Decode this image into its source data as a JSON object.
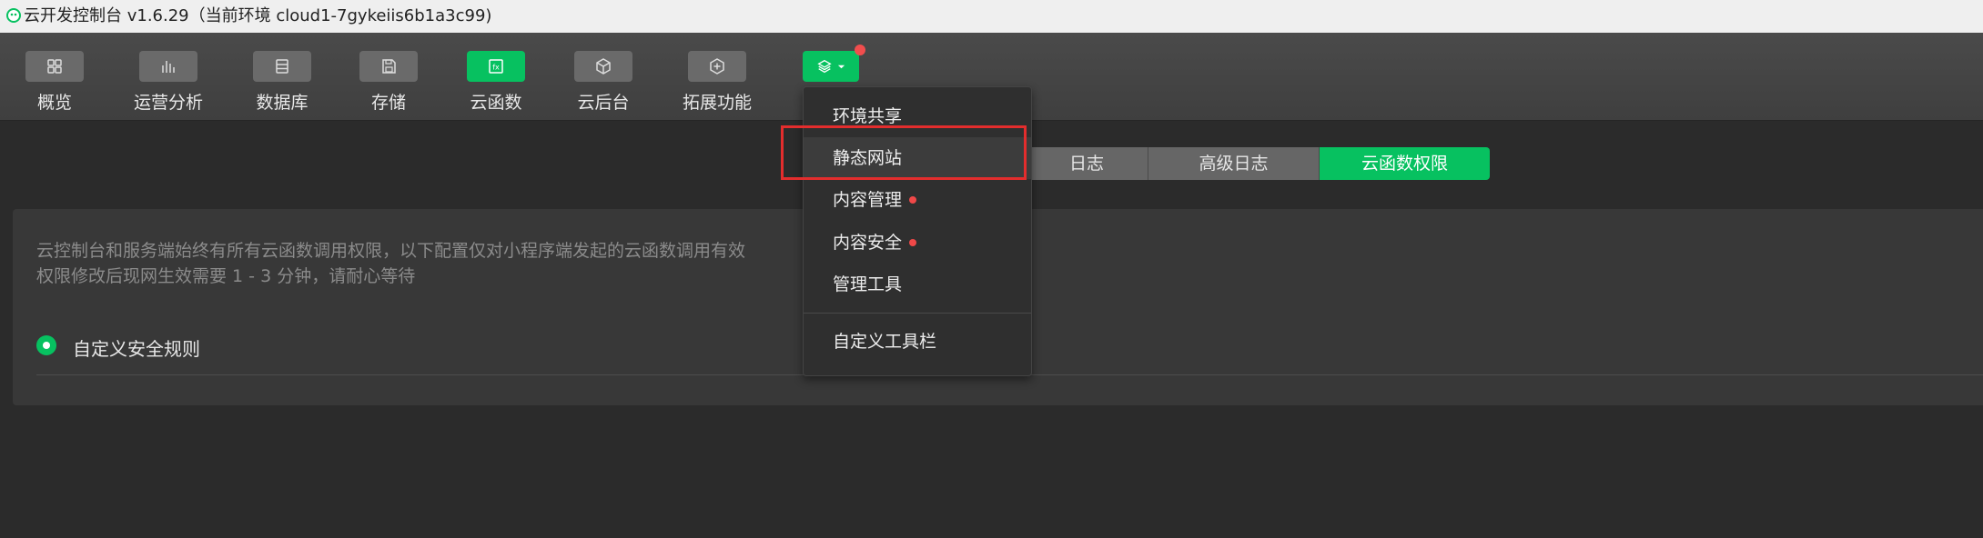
{
  "window": {
    "title": "云开发控制台 v1.6.29（当前环境 cloud1-7gykeiis6b1a3c99)"
  },
  "toolbar": {
    "items": [
      {
        "label": "概览",
        "icon": "grid-icon"
      },
      {
        "label": "运营分析",
        "icon": "bar-chart-icon"
      },
      {
        "label": "数据库",
        "icon": "database-icon"
      },
      {
        "label": "存储",
        "icon": "save-icon"
      },
      {
        "label": "云函数",
        "icon": "function-icon",
        "active": true
      },
      {
        "label": "云后台",
        "icon": "cube-icon"
      },
      {
        "label": "拓展功能",
        "icon": "plus-hex-icon"
      }
    ],
    "extension_button_icon": "layers-icon"
  },
  "tabs": [
    {
      "label": "日志"
    },
    {
      "label": "高级日志"
    },
    {
      "label": "云函数权限",
      "active": true
    }
  ],
  "panel": {
    "description_line1": "云控制台和服务端始终有所有云函数调用权限，以下配置仅对小程序端发起的云函数调用有效",
    "description_line2": "权限修改后现网生效需要 1 - 3 分钟，请耐心等待",
    "radio_label": "自定义安全规则"
  },
  "dropdown": {
    "items": [
      {
        "label": "环境共享"
      },
      {
        "label": "静态网站",
        "hover": true
      },
      {
        "label": "内容管理",
        "dot": true
      },
      {
        "label": "内容安全",
        "dot": true
      },
      {
        "label": "管理工具"
      },
      {
        "label": "自定义工具栏"
      }
    ]
  },
  "colors": {
    "accent": "#07c160",
    "badge": "#f14d4d",
    "highlight": "#e32d2d"
  }
}
